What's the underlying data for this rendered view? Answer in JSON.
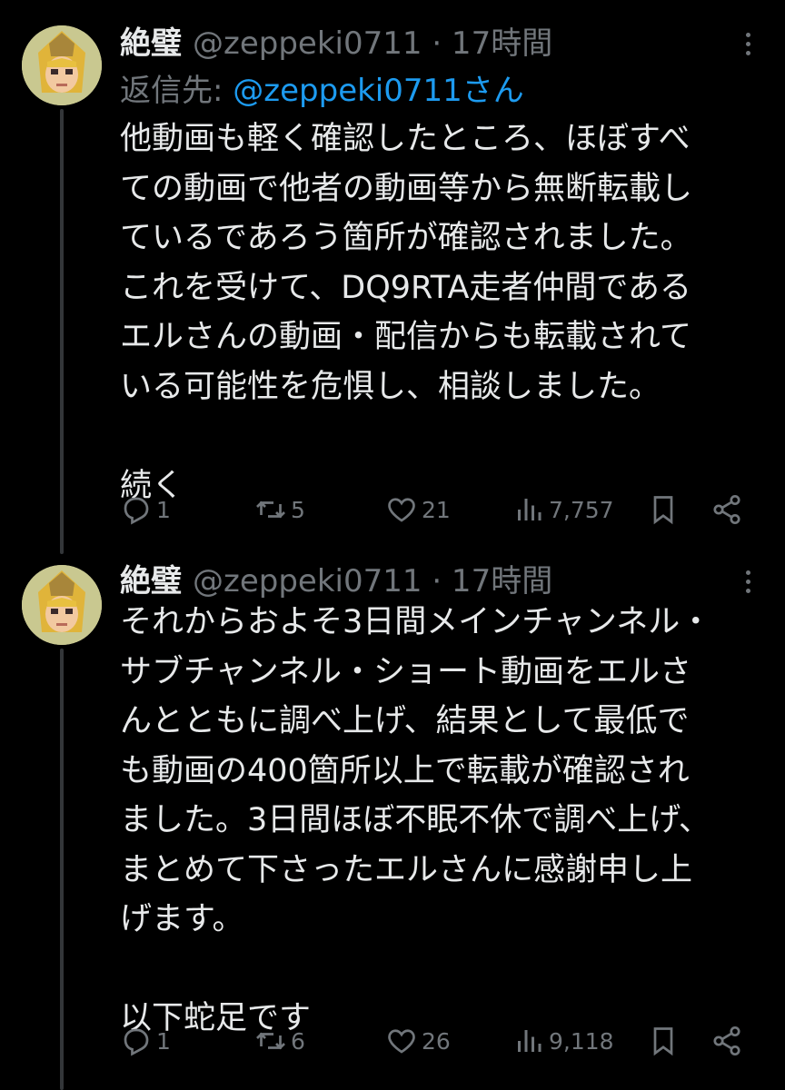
{
  "colors": {
    "background": "#000000",
    "text_primary": "#e7e9ea",
    "text_secondary": "#71767b",
    "mention": "#1d9bf0",
    "thread_line": "#333639"
  },
  "tweets": [
    {
      "author_name": "絶璧",
      "handle_time": "@zeppeki0711 · 17時間",
      "reply_prefix": "返信先: ",
      "reply_mention": "@zeppeki0711さん",
      "body": "他動画も軽く確認したところ、ほぼすべ\nての動画で他者の動画等から無断転載し\nているであろう箇所が確認されました。\nこれを受けて、DQ9RTA走者仲間である\nエルさんの動画・配信からも転載されて\nいる可能性を危惧し、相談しました。\n\n続く",
      "replies": "1",
      "retweets": "5",
      "likes": "21",
      "views": "7,757",
      "icons": [
        "reply-icon",
        "retweet-icon",
        "like-icon",
        "views-icon",
        "bookmark-icon",
        "share-icon"
      ]
    },
    {
      "author_name": "絶璧",
      "handle_time": "@zeppeki0711 · 17時間",
      "body": "それからおよそ3日間メインチャンネル・\nサブチャンネル・ショート動画をエルさ\nんとともに調べ上げ、結果として最低で\nも動画の400箇所以上で転載が確認され\nました。3日間ほぼ不眠不休で調べ上げ、\nまとめて下さったエルさんに感謝申し上\nげます。\n\n以下蛇足です",
      "replies": "1",
      "retweets": "6",
      "likes": "26",
      "views": "9,118",
      "icons": [
        "reply-icon",
        "retweet-icon",
        "like-icon",
        "views-icon",
        "bookmark-icon",
        "share-icon"
      ]
    }
  ]
}
